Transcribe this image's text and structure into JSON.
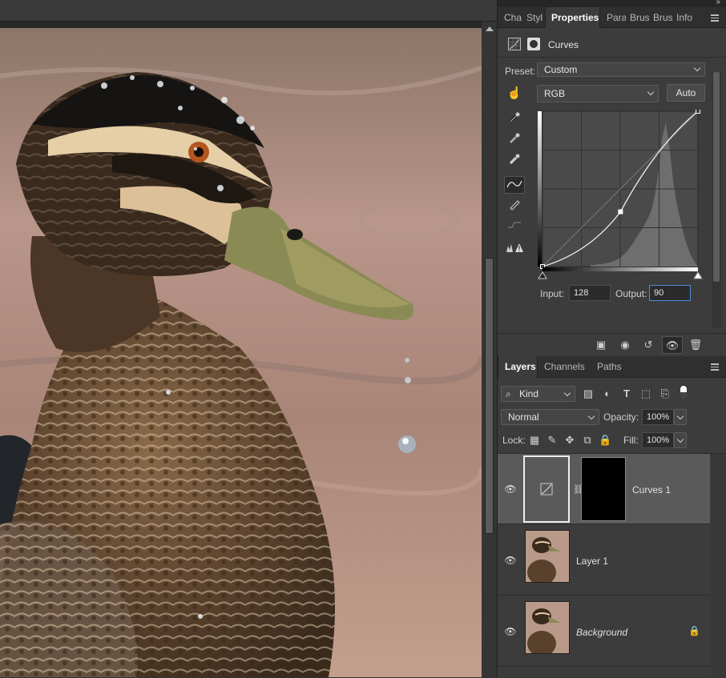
{
  "properties_panel": {
    "tabs": [
      "Cha",
      "Styl",
      "Properties",
      "Para",
      "Brus",
      "Brus",
      "Info"
    ],
    "title": "Curves",
    "preset_label": "Preset:",
    "preset_value": "Custom",
    "channel_value": "RGB",
    "auto_label": "Auto",
    "input_label": "Input:",
    "input_value": "128",
    "output_label": "Output:",
    "output_value": "90",
    "tools": [
      "on-image-adjust-icon",
      "black-point-eyedropper-icon",
      "gray-point-eyedropper-icon",
      "white-point-eyedropper-icon",
      "curve-points-icon",
      "pencil-icon",
      "smooth-icon",
      "clipping-warning-icon"
    ],
    "footer_icons": [
      "clip-to-layer-icon",
      "view-previous-icon",
      "reset-icon",
      "visibility-icon",
      "delete-icon"
    ],
    "curve": {
      "points": [
        [
          0,
          0
        ],
        [
          128,
          90
        ],
        [
          255,
          255
        ]
      ],
      "range": [
        0,
        255
      ]
    }
  },
  "layers_panel": {
    "tabs": [
      "Layers",
      "Channels",
      "Paths"
    ],
    "filter_kind": "Kind",
    "blend_mode": "Normal",
    "opacity_label": "Opacity:",
    "opacity_value": "100%",
    "lock_label": "Lock:",
    "fill_label": "Fill:",
    "fill_value": "100%",
    "layers": [
      {
        "name": "Curves 1",
        "selected": true
      },
      {
        "name": "Layer 1",
        "selected": false
      },
      {
        "name": "Background",
        "selected": false,
        "locked": true
      }
    ]
  },
  "colors": {
    "panel": "#3c3c3c",
    "accent_focus": "#4c8cd6",
    "canvas_bg": "#282828"
  }
}
